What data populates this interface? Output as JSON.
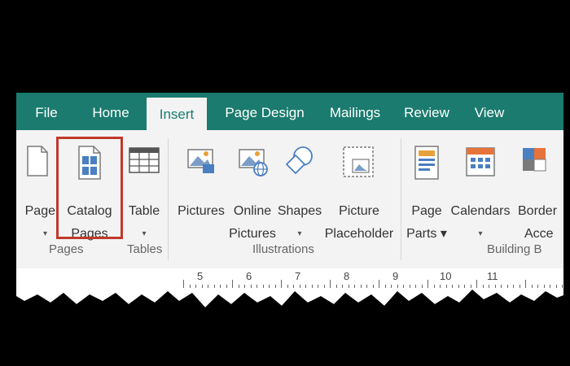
{
  "tabs": [
    {
      "label": "File"
    },
    {
      "label": "Home"
    },
    {
      "label": "Insert"
    },
    {
      "label": "Page Design"
    },
    {
      "label": "Mailings"
    },
    {
      "label": "Review"
    },
    {
      "label": "View"
    }
  ],
  "buttons": {
    "page": {
      "label": "Page",
      "caret": "▾"
    },
    "catalog_pages": {
      "label_line1": "Catalog",
      "label_line2": "Pages"
    },
    "table": {
      "label": "Table",
      "caret": "▾"
    },
    "pictures": {
      "label": "Pictures"
    },
    "online_pictures": {
      "label_line1": "Online",
      "label_line2": "Pictures"
    },
    "shapes": {
      "label": "Shapes",
      "caret": "▾"
    },
    "picture_placeholder": {
      "label_line1": "Picture",
      "label_line2": "Placeholder"
    },
    "page_parts": {
      "label_line1": "Page",
      "label_line2": "Parts ▾"
    },
    "calendars": {
      "label": "Calendars",
      "caret": "▾"
    },
    "borders_accents": {
      "label_line1": "Border",
      "label_line2": "Acce"
    }
  },
  "groups": {
    "pages": "Pages",
    "tables": "Tables",
    "illustrations": "Illustrations",
    "building_blocks": "Building B"
  },
  "ruler": {
    "numbers": [
      "5",
      "6",
      "7",
      "8",
      "9",
      "10",
      "11"
    ]
  },
  "colors": {
    "tab_bar": "#1a7b6e",
    "ribbon": "#f3f3f3",
    "highlight": "#c0392b",
    "icon_blue": "#4a7fc1",
    "icon_orange": "#e8a13a"
  }
}
